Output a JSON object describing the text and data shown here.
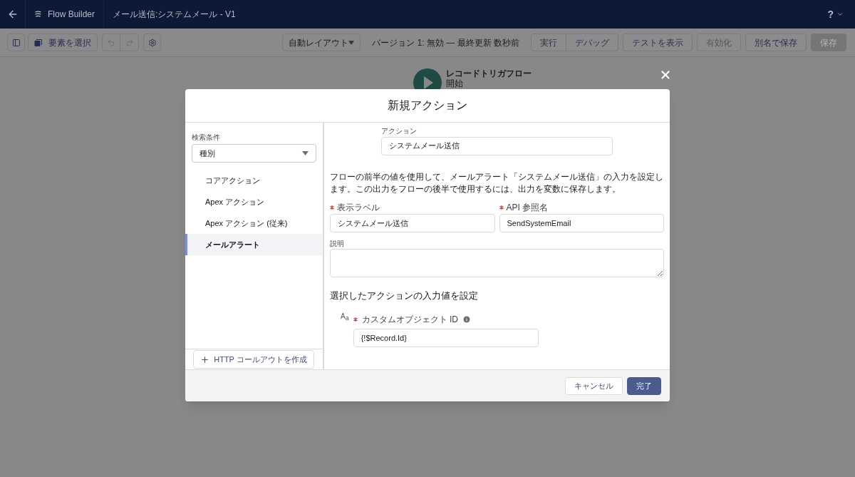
{
  "header": {
    "app_name": "Flow Builder",
    "title": "メール送信:システムメール - V1",
    "help": "?"
  },
  "toolbar": {
    "select_button": "要素を選択",
    "layout_dropdown": "自動レイアウト",
    "status": "バージョン 1: 無効 — 最終更新 数秒前",
    "button_groups": [
      [
        {
          "label": "実行",
          "disabled": false,
          "kind": "outline"
        },
        {
          "label": "デバッグ",
          "disabled": false,
          "kind": "outline"
        }
      ],
      [
        {
          "label": "テストを表示",
          "disabled": false,
          "kind": "outline"
        }
      ],
      [
        {
          "label": "有効化",
          "disabled": true,
          "kind": "outline"
        }
      ],
      [
        {
          "label": "別名で保存",
          "disabled": false,
          "kind": "outline"
        }
      ],
      [
        {
          "label": "保存",
          "disabled": true,
          "kind": "brand"
        }
      ]
    ]
  },
  "canvas": {
    "start_node": {
      "title": "レコードトリガフロー",
      "subtitle": "開始"
    }
  },
  "modal": {
    "title": "新規アクション",
    "filter": {
      "label": "検索条件",
      "value": "種別"
    },
    "categories": [
      {
        "label": "コアアクション",
        "selected": false
      },
      {
        "label": "Apex アクション",
        "selected": false
      },
      {
        "label": "Apex アクション (従来)",
        "selected": false
      },
      {
        "label": "メールアラート",
        "selected": true
      }
    ],
    "http_button": "HTTP コールアウトを作成",
    "action": {
      "label": "アクション",
      "value": "システムメール送信"
    },
    "description": "フローの前半の値を使用して、メールアラート「システムメール送信」の入力を設定します。この出力をフローの後半で使用するには、出力を変数に保存します。",
    "fields": [
      {
        "label": "表示ラベル",
        "required": true,
        "value": "システムメール送信"
      },
      {
        "label": "API 参照名",
        "required": true,
        "value": "SendSystemEmail"
      }
    ],
    "notes": {
      "label": "説明"
    },
    "section_title": "選択したアクションの入力値を設定",
    "parameter": {
      "type_icon": "A",
      "type_icon_sub": "a",
      "label": "カスタムオブジェクト ID",
      "required": true,
      "value": "{!$Record.Id}"
    },
    "cancel": "キャンセル",
    "done": "完了"
  }
}
